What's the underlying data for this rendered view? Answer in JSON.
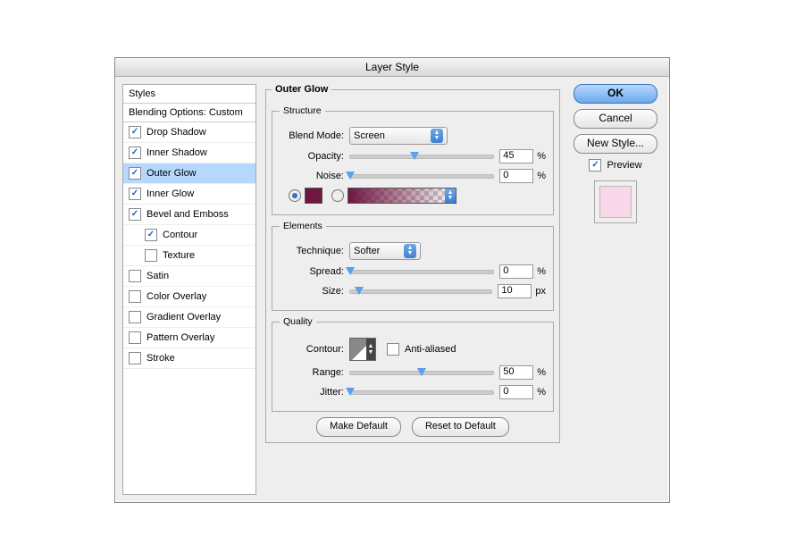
{
  "dialog_title": "Layer Style",
  "styles_panel": {
    "header": "Styles",
    "sub": "Blending Options: Custom",
    "items": [
      {
        "label": "Drop Shadow",
        "checked": true,
        "selected": false,
        "indent": false
      },
      {
        "label": "Inner Shadow",
        "checked": true,
        "selected": false,
        "indent": false
      },
      {
        "label": "Outer Glow",
        "checked": true,
        "selected": true,
        "indent": false
      },
      {
        "label": "Inner Glow",
        "checked": true,
        "selected": false,
        "indent": false
      },
      {
        "label": "Bevel and Emboss",
        "checked": true,
        "selected": false,
        "indent": false
      },
      {
        "label": "Contour",
        "checked": true,
        "selected": false,
        "indent": true
      },
      {
        "label": "Texture",
        "checked": false,
        "selected": false,
        "indent": true
      },
      {
        "label": "Satin",
        "checked": false,
        "selected": false,
        "indent": false
      },
      {
        "label": "Color Overlay",
        "checked": false,
        "selected": false,
        "indent": false
      },
      {
        "label": "Gradient Overlay",
        "checked": false,
        "selected": false,
        "indent": false
      },
      {
        "label": "Pattern Overlay",
        "checked": false,
        "selected": false,
        "indent": false
      },
      {
        "label": "Stroke",
        "checked": false,
        "selected": false,
        "indent": false
      }
    ]
  },
  "section_title": "Outer Glow",
  "structure": {
    "legend": "Structure",
    "blend_mode_label": "Blend Mode:",
    "blend_mode_value": "Screen",
    "opacity_label": "Opacity:",
    "opacity_value": "45",
    "opacity_unit": "%",
    "noise_label": "Noise:",
    "noise_value": "0",
    "noise_unit": "%",
    "color_swatch": "#6e1740",
    "color_radio_selected": true,
    "gradient_radio_selected": false
  },
  "elements": {
    "legend": "Elements",
    "technique_label": "Technique:",
    "technique_value": "Softer",
    "spread_label": "Spread:",
    "spread_value": "0",
    "spread_unit": "%",
    "size_label": "Size:",
    "size_value": "10",
    "size_unit": "px"
  },
  "quality": {
    "legend": "Quality",
    "contour_label": "Contour:",
    "antialiased_label": "Anti-aliased",
    "antialiased_checked": false,
    "range_label": "Range:",
    "range_value": "50",
    "range_unit": "%",
    "jitter_label": "Jitter:",
    "jitter_value": "0",
    "jitter_unit": "%"
  },
  "buttons": {
    "make_default": "Make Default",
    "reset_default": "Reset to Default",
    "ok": "OK",
    "cancel": "Cancel",
    "new_style": "New Style...",
    "preview": "Preview",
    "preview_checked": true
  }
}
